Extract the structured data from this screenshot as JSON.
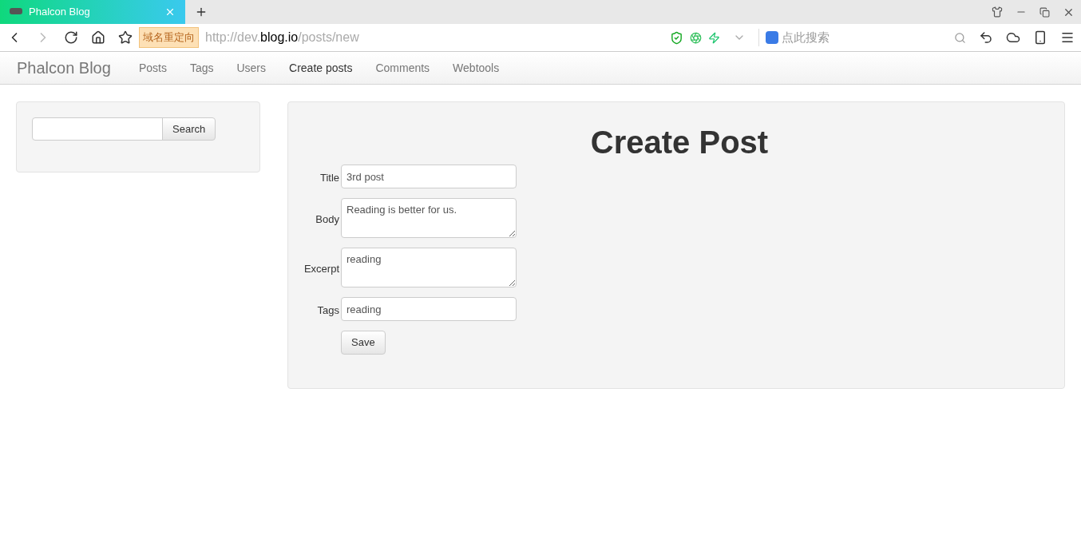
{
  "browser": {
    "tab": {
      "title": "Phalcon Blog",
      "selected": true
    },
    "redirect_badge": "域名重定向",
    "url": {
      "scheme_host": "http://dev.",
      "domain": "blog.io",
      "path": "/posts/new"
    },
    "search_placeholder": "点此搜索"
  },
  "navbar": {
    "brand": "Phalcon Blog",
    "items": [
      {
        "label": "Posts",
        "selected": false
      },
      {
        "label": "Tags",
        "selected": false
      },
      {
        "label": "Users",
        "selected": false
      },
      {
        "label": "Create posts",
        "selected": true
      },
      {
        "label": "Comments",
        "selected": false
      },
      {
        "label": "Webtools",
        "selected": false
      }
    ]
  },
  "sidebar": {
    "search_button": "Search"
  },
  "form": {
    "heading": "Create Post",
    "fields": [
      {
        "label": "Title",
        "kind": "input",
        "value": "3rd post"
      },
      {
        "label": "Body",
        "kind": "textarea",
        "value": "Reading is better for us."
      },
      {
        "label": "Excerpt",
        "kind": "textarea",
        "value": "reading"
      },
      {
        "label": "Tags",
        "kind": "input",
        "value": "reading"
      }
    ],
    "save_button": "Save"
  }
}
